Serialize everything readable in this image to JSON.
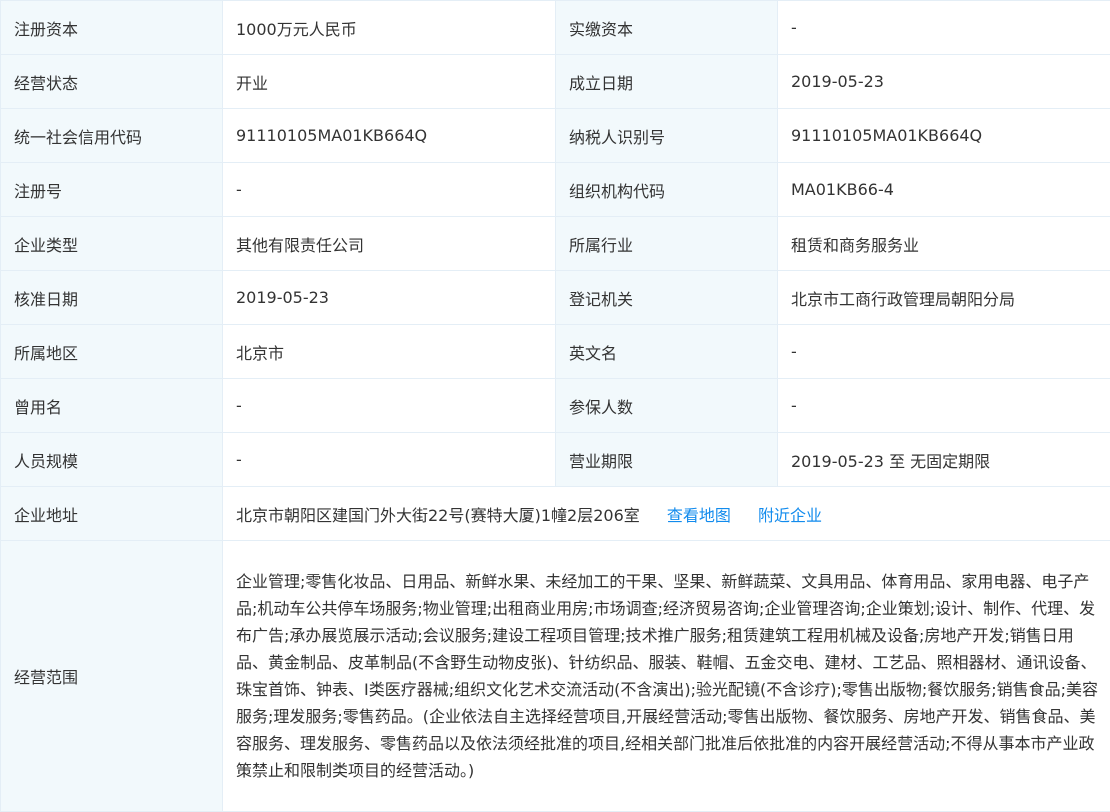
{
  "rows": [
    {
      "l1": "注册资本",
      "v1": "1000万元人民币",
      "l2": "实缴资本",
      "v2": "-"
    },
    {
      "l1": "经营状态",
      "v1": "开业",
      "l2": "成立日期",
      "v2": "2019-05-23"
    },
    {
      "l1": "统一社会信用代码",
      "v1": "91110105MA01KB664Q",
      "l2": "纳税人识别号",
      "v2": "91110105MA01KB664Q"
    },
    {
      "l1": "注册号",
      "v1": "-",
      "l2": "组织机构代码",
      "v2": "MA01KB66-4"
    },
    {
      "l1": "企业类型",
      "v1": "其他有限责任公司",
      "l2": "所属行业",
      "v2": "租赁和商务服务业"
    },
    {
      "l1": "核准日期",
      "v1": "2019-05-23",
      "l2": "登记机关",
      "v2": "北京市工商行政管理局朝阳分局"
    },
    {
      "l1": "所属地区",
      "v1": "北京市",
      "l2": "英文名",
      "v2": "-"
    },
    {
      "l1": "曾用名",
      "v1": "-",
      "l2": "参保人数",
      "v2": "-"
    },
    {
      "l1": "人员规模",
      "v1": "-",
      "l2": "营业期限",
      "v2": "2019-05-23 至 无固定期限"
    }
  ],
  "address": {
    "label": "企业地址",
    "value": "北京市朝阳区建国门外大街22号(赛特大厦)1幢2层206室",
    "map_link": "查看地图",
    "nearby_link": "附近企业"
  },
  "scope": {
    "label": "经营范围",
    "value": "企业管理;零售化妆品、日用品、新鲜水果、未经加工的干果、坚果、新鲜蔬菜、文具用品、体育用品、家用电器、电子产品;机动车公共停车场服务;物业管理;出租商业用房;市场调查;经济贸易咨询;企业管理咨询;企业策划;设计、制作、代理、发布广告;承办展览展示活动;会议服务;建设工程项目管理;技术推广服务;租赁建筑工程用机械及设备;房地产开发;销售日用品、黄金制品、皮革制品(不含野生动物皮张)、针纺织品、服装、鞋帽、五金交电、建材、工艺品、照相器材、通讯设备、珠宝首饰、钟表、I类医疗器械;组织文化艺术交流活动(不含演出);验光配镜(不含诊疗);零售出版物;餐饮服务;销售食品;美容服务;理发服务;零售药品。(企业依法自主选择经营项目,开展经营活动;零售出版物、餐饮服务、房地产开发、销售食品、美容服务、理发服务、零售药品以及依法须经批准的项目,经相关部门批准后依批准的内容开展经营活动;不得从事本市产业政策禁止和限制类项目的经营活动。)"
  },
  "colors": {
    "label_bg": "#f2f9fc",
    "border": "#e4eef6",
    "text": "#333333",
    "link": "#128bed"
  }
}
